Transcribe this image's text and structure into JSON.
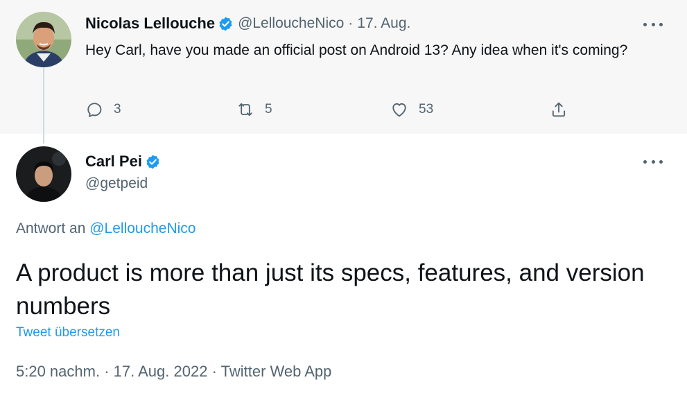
{
  "parent_tweet": {
    "author_name": "Nicolas Lellouche",
    "author_handle": "@LelloucheNico",
    "separator": "·",
    "date": "17. Aug.",
    "text": "Hey Carl, have you made an official post on Android 13? Any idea when it's coming?",
    "actions": {
      "reply_count": "3",
      "retweet_count": "5",
      "like_count": "53"
    }
  },
  "reply_tweet": {
    "author_name": "Carl Pei",
    "author_handle": "@getpeid",
    "replying_to_prefix": "Antwort an",
    "replying_to_handle": "@LelloucheNico",
    "text": "A product is more than just its specs, features, and version numbers",
    "translate_label": "Tweet übersetzen",
    "meta": {
      "time": "5:20 nachm.",
      "separator": "·",
      "date": "17. Aug. 2022",
      "source": "Twitter Web App"
    }
  },
  "icons": {
    "verified": "verified-badge-icon",
    "more": "more-options-icon",
    "reply": "reply-icon",
    "retweet": "retweet-icon",
    "like": "heart-icon",
    "share": "share-icon"
  },
  "colors": {
    "accent": "#1d9bf0",
    "secondary_text": "#536471",
    "primary_text": "#0f1419",
    "parent_background": "#f7f7f7"
  }
}
